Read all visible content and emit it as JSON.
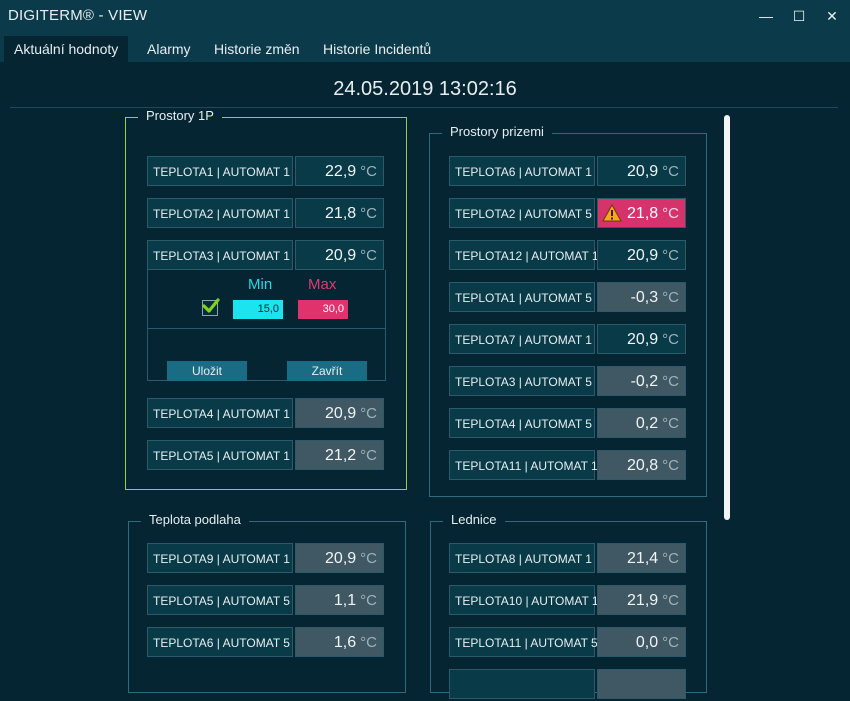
{
  "window": {
    "title": "DIGITERM® - VIEW",
    "min_symbol": "—",
    "max_symbol": "☐",
    "close_symbol": "✕"
  },
  "tabs": [
    {
      "label": "Aktuální hodnoty",
      "active": true
    },
    {
      "label": "Alarmy",
      "active": false
    },
    {
      "label": "Historie změn",
      "active": false
    },
    {
      "label": "Historie Incidentů",
      "active": false
    }
  ],
  "datetime": "24.05.2019 13:02:16",
  "unit": "°C",
  "colors": {
    "alarm": "#d6336c",
    "min": "#1be3ef",
    "max": "#e0336d",
    "selected_border": "#9ccc3c"
  },
  "groups": {
    "prostory_1p": {
      "title": "Prostory 1P",
      "rows": [
        {
          "label": "TEPLOTA1 | AUTOMAT 1",
          "value": "22,9"
        },
        {
          "label": "TEPLOTA2 | AUTOMAT 1",
          "value": "21,8"
        },
        {
          "label": "TEPLOTA3 | AUTOMAT 1",
          "value": "20,9"
        },
        {
          "label": "TEPLOTA4 | AUTOMAT 1",
          "value": "20,9"
        },
        {
          "label": "TEPLOTA5 | AUTOMAT 1",
          "value": "21,2"
        }
      ],
      "limits": {
        "min_label": "Min",
        "max_label": "Max",
        "min_value": "15,0",
        "max_value": "30,0",
        "enabled": true,
        "save_label": "Uložit",
        "close_label": "Zavřít"
      }
    },
    "prostory_prizemi": {
      "title": "Prostory prizemi",
      "rows": [
        {
          "label": "TEPLOTA6 | AUTOMAT 1",
          "value": "20,9"
        },
        {
          "label": "TEPLOTA2 | AUTOMAT 5",
          "value": "21,8",
          "alarm": true
        },
        {
          "label": "TEPLOTA12 | AUTOMAT 1",
          "value": "20,9"
        },
        {
          "label": "TEPLOTA1 | AUTOMAT 5",
          "value": "-0,3"
        },
        {
          "label": "TEPLOTA7 | AUTOMAT 1",
          "value": "20,9"
        },
        {
          "label": "TEPLOTA3 | AUTOMAT 5",
          "value": "-0,2"
        },
        {
          "label": "TEPLOTA4 | AUTOMAT 5",
          "value": "0,2"
        },
        {
          "label": "TEPLOTA11 | AUTOMAT 1",
          "value": "20,8"
        }
      ]
    },
    "teplota_podlaha": {
      "title": "Teplota podlaha",
      "rows": [
        {
          "label": "TEPLOTA9 | AUTOMAT 1",
          "value": "20,9"
        },
        {
          "label": "TEPLOTA5 | AUTOMAT 5",
          "value": "1,1"
        },
        {
          "label": "TEPLOTA6 | AUTOMAT 5",
          "value": "1,6"
        }
      ]
    },
    "lednice": {
      "title": "Lednice",
      "rows": [
        {
          "label": "TEPLOTA8 | AUTOMAT 1",
          "value": "21,4"
        },
        {
          "label": "TEPLOTA10 | AUTOMAT 1",
          "value": "21,9"
        },
        {
          "label": "TEPLOTA11 | AUTOMAT 5",
          "value": "0,0"
        }
      ]
    }
  }
}
